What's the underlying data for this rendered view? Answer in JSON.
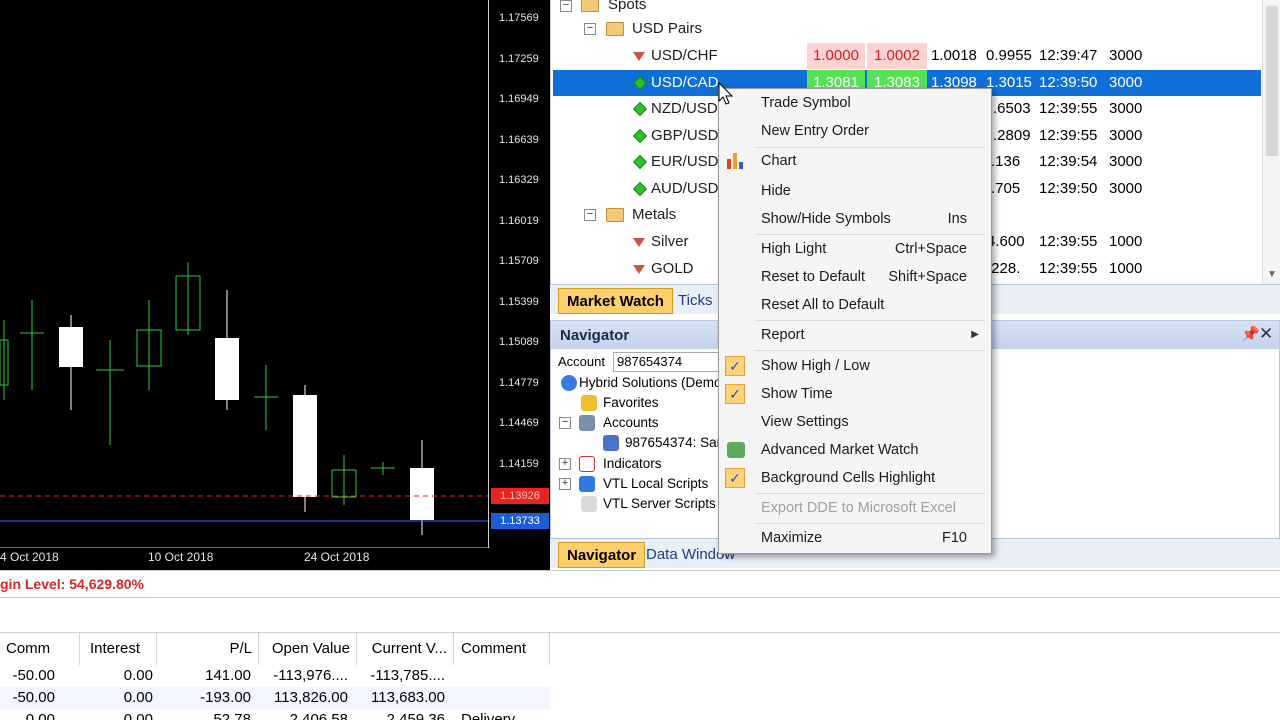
{
  "chart": {
    "price_ticks": [
      "1.17569",
      "1.17259",
      "1.16949",
      "1.16639",
      "1.16329",
      "1.16019",
      "1.15709",
      "1.15399",
      "1.15089",
      "1.14779",
      "1.14469",
      "1.14159"
    ],
    "bid_tag": "1.13926",
    "ask_tag": "1.13733",
    "x_labels": [
      "4 Oct 2018",
      "10 Oct 2018",
      "24 Oct 2018"
    ]
  },
  "market_watch": {
    "folders": {
      "spots": "Spots",
      "usd_pairs": "USD Pairs",
      "metals": "Metals"
    },
    "rows": [
      {
        "symbol": "USD/CHF",
        "bid": "1.0000",
        "ask": "1.0002",
        "high": "1.0018",
        "low": "0.9955",
        "time": "12:39:47",
        "volume": "3000"
      },
      {
        "symbol": "USD/CAD",
        "bid": "1.3081",
        "ask": "1.3083",
        "high": "1.3098",
        "low": "1.3015",
        "time": "12:39:50",
        "volume": "3000"
      },
      {
        "symbol": "NZD/USD",
        "low": ".6503",
        "time": "12:39:55",
        "volume": "3000"
      },
      {
        "symbol": "GBP/USD",
        "low": ".2809",
        "time": "12:39:55",
        "volume": "3000"
      },
      {
        "symbol": "EUR/USD",
        "low": ".136",
        "time": "12:39:54",
        "volume": "3000"
      },
      {
        "symbol": "AUD/USD",
        "low": ".705",
        "time": "12:39:50",
        "volume": "3000"
      },
      {
        "symbol": "Silver",
        "low": "4.600",
        "time": "12:39:55",
        "volume": "1000"
      },
      {
        "symbol": "GOLD",
        "low": ".228.",
        "time": "12:39:55",
        "volume": "1000"
      }
    ],
    "tabs": {
      "market_watch": "Market Watch",
      "ticks": "Ticks"
    }
  },
  "navigator": {
    "title": "Navigator",
    "account_label": "Account",
    "account_value": "987654374",
    "items": {
      "server": "Hybrid Solutions (Demo",
      "favorites": "Favorites",
      "accounts": "Accounts",
      "account_entry": "987654374: Sar",
      "indicators": "Indicators",
      "local_scripts": "VTL Local Scripts",
      "server_scripts": "VTL Server Scripts"
    },
    "tabs": {
      "navigator": "Navigator",
      "data_window": "Data Window"
    }
  },
  "context_menu": {
    "trade_symbol": "Trade Symbol",
    "new_entry_order": "New Entry Order",
    "chart": "Chart",
    "hide": "Hide",
    "show_hide_symbols": "Show/Hide Symbols",
    "show_hide_symbols_key": "Ins",
    "high_light": "High Light",
    "high_light_key": "Ctrl+Space",
    "reset_to_default": "Reset to Default",
    "reset_to_default_key": "Shift+Space",
    "reset_all_to_default": "Reset All to Default",
    "report": "Report",
    "show_high_low": "Show High / Low",
    "show_time": "Show Time",
    "view_settings": "View Settings",
    "advanced_market_watch": "Advanced Market Watch",
    "background_cells_highlight": "Background Cells Highlight",
    "export_dde": "Export DDE to Microsoft Excel",
    "maximize": "Maximize",
    "maximize_key": "F10"
  },
  "status": {
    "margin_level": "gin Level: 54,629.80%"
  },
  "terminal": {
    "headers": {
      "comm": "Comm",
      "interest": "Interest",
      "pl": "P/L",
      "open_value": "Open Value",
      "current_value": "Current V...",
      "comment": "Comment"
    },
    "rows": [
      {
        "comm": "-50.00",
        "interest": "0.00",
        "pl": "141.00",
        "open_value": "-113,976....",
        "current_value": "-113,785....",
        "comment": ""
      },
      {
        "comm": "-50.00",
        "interest": "0.00",
        "pl": "-193.00",
        "open_value": "113,826.00",
        "current_value": "113,683.00",
        "comment": ""
      },
      {
        "comm": "0.00",
        "interest": "0.00",
        "pl": "52.78",
        "open_value": "2,406.58",
        "current_value": "2,459.36",
        "comment": "Delivery"
      }
    ]
  },
  "colors": {
    "selection": "#0f6fd8",
    "bid_red_bg": "#ffd3d3",
    "bid_green_bg": "#56e156",
    "active_tab": "#ffcf6b",
    "margin_level_text": "#d92525"
  }
}
